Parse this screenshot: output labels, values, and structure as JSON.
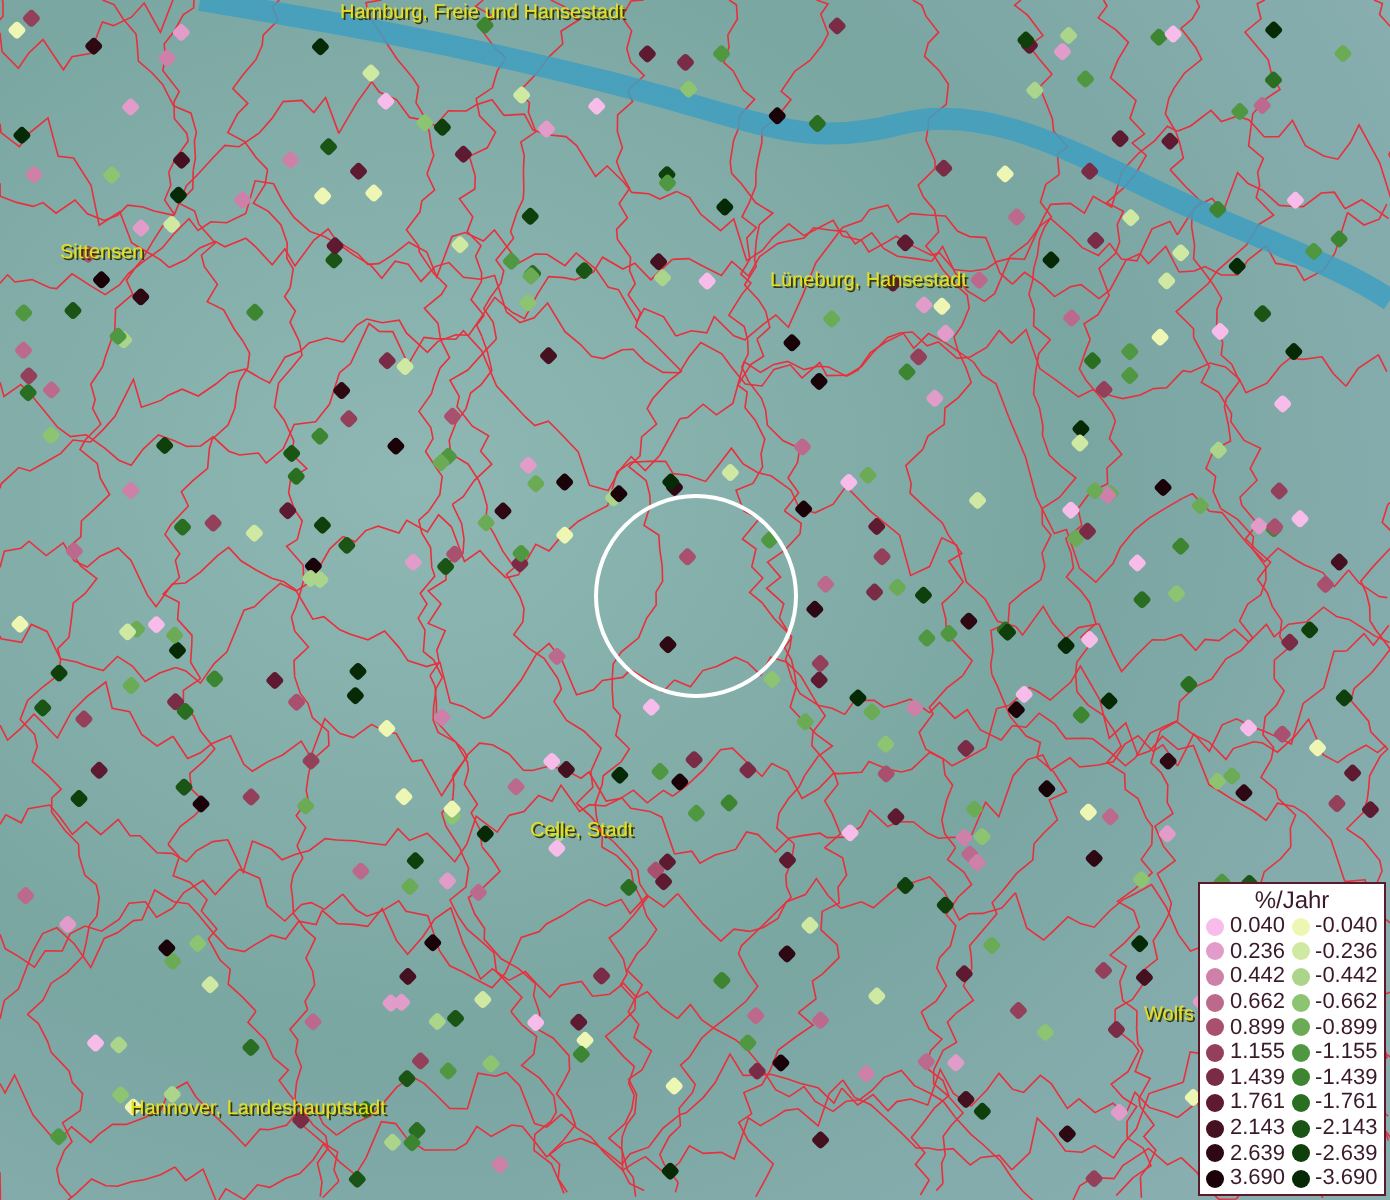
{
  "map": {
    "labels": [
      {
        "text": "Hamburg, Freie und Hansestadt"
      },
      {
        "text": "Sittensen"
      },
      {
        "text": "Lüneburg, Hansestadt"
      },
      {
        "text": "Celle, Stadt"
      },
      {
        "text": "Hannover, Landeshauptstadt"
      },
      {
        "text": "Wolfs"
      }
    ]
  },
  "legend": {
    "title": "%/Jahr",
    "rows": [
      {
        "positive": {
          "value": "0.040",
          "color": "#f7bce9"
        },
        "negative": {
          "value": "-0.040",
          "color": "#eef6b4"
        }
      },
      {
        "positive": {
          "value": "0.236",
          "color": "#e29cc9"
        },
        "negative": {
          "value": "-0.236",
          "color": "#cfe8a2"
        }
      },
      {
        "positive": {
          "value": "0.442",
          "color": "#cd80a8"
        },
        "negative": {
          "value": "-0.442",
          "color": "#aad58b"
        }
      },
      {
        "positive": {
          "value": "0.662",
          "color": "#bb6a8e"
        },
        "negative": {
          "value": "-0.662",
          "color": "#8cc471"
        }
      },
      {
        "positive": {
          "value": "0.899",
          "color": "#a8506e"
        },
        "negative": {
          "value": "-0.899",
          "color": "#6bab56"
        }
      },
      {
        "positive": {
          "value": "1.155",
          "color": "#94405a"
        },
        "negative": {
          "value": "-1.155",
          "color": "#4f9841"
        }
      },
      {
        "positive": {
          "value": "1.439",
          "color": "#7a2b45"
        },
        "negative": {
          "value": "-1.439",
          "color": "#3d8531"
        }
      },
      {
        "positive": {
          "value": "1.761",
          "color": "#5e1a30"
        },
        "negative": {
          "value": "-1.761",
          "color": "#2a6e22"
        }
      },
      {
        "positive": {
          "value": "2.143",
          "color": "#451020"
        },
        "negative": {
          "value": "-2.143",
          "color": "#1a5515"
        }
      },
      {
        "positive": {
          "value": "2.639",
          "color": "#2e0812"
        },
        "negative": {
          "value": "-2.639",
          "color": "#0f400c"
        }
      },
      {
        "positive": {
          "value": "3.690",
          "color": "#1a0308"
        },
        "negative": {
          "value": "-3.690",
          "color": "#062a06"
        }
      }
    ]
  }
}
